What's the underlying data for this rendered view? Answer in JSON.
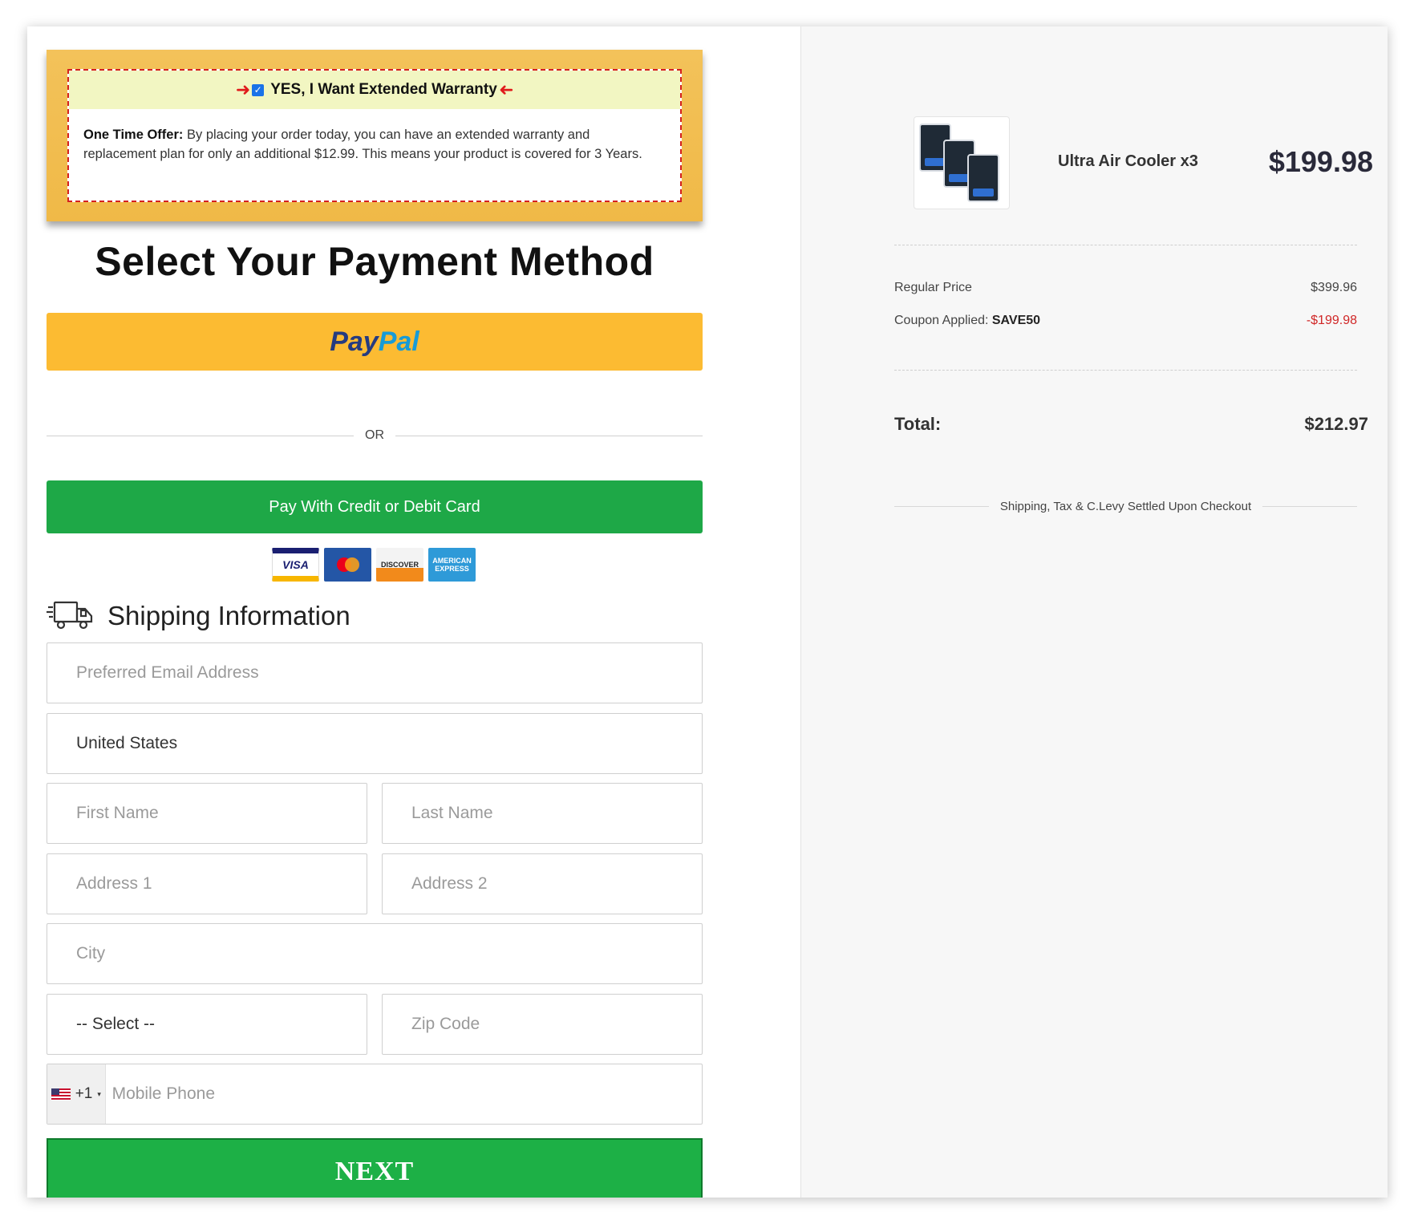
{
  "warranty": {
    "checkbox_checked": true,
    "heading": "YES, I Want Extended Warranty",
    "offer_label": "One Time Offer:",
    "offer_text": " By placing your order today, you can have an extended warranty and replacement plan for only an additional $12.99. This means your product is covered for 3 Years."
  },
  "payment": {
    "title": "Select Your Payment Method",
    "paypal_part1": "Pay",
    "paypal_part2": "Pal",
    "or_text": "OR",
    "card_button": "Pay With Credit or Debit Card",
    "card_logos": [
      "VISA",
      "MasterCard",
      "DISCOVER",
      "AMERICAN EXPRESS"
    ]
  },
  "shipping": {
    "title": "Shipping Information",
    "email_placeholder": "Preferred Email Address",
    "country_value": "United States",
    "first_name_placeholder": "First Name",
    "last_name_placeholder": "Last Name",
    "address1_placeholder": "Address 1",
    "address2_placeholder": "Address 2",
    "city_placeholder": "City",
    "state_value": "-- Select --",
    "zip_placeholder": "Zip Code",
    "phone_prefix": "+1",
    "phone_placeholder": "Mobile Phone",
    "next_button": "NEXT"
  },
  "summary": {
    "product_name": "Ultra Air Cooler x3",
    "product_price": "$199.98",
    "regular_price_label": "Regular Price",
    "regular_price_value": "$399.96",
    "coupon_label": "Coupon Applied: ",
    "coupon_code": "SAVE50",
    "coupon_value": "-$199.98",
    "total_label": "Total:",
    "total_value": "$212.97",
    "shipping_note": "Shipping, Tax & C.Levy Settled Upon Checkout"
  },
  "colors": {
    "paypal_yellow": "#fcbb32",
    "card_green": "#1ea847",
    "next_green": "#1db046",
    "warranty_gold": "#f0b947",
    "warranty_border_red": "#d42020",
    "discount_red": "#d02626"
  },
  "icons": {
    "truck": "delivery-truck-icon",
    "arrow_left": "arrow-right-icon",
    "arrow_right": "arrow-left-icon"
  }
}
